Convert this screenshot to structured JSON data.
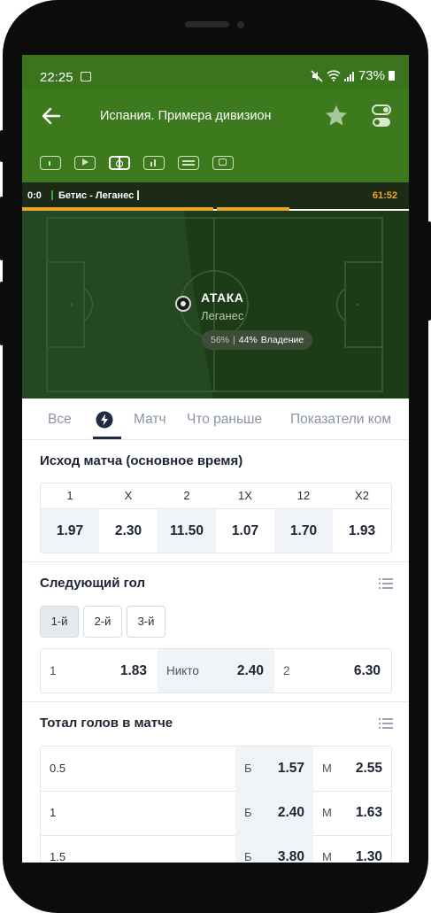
{
  "status": {
    "time": "22:25",
    "battery": "73%"
  },
  "header": {
    "title": "Испания. Примера дивизион"
  },
  "scoreboard": {
    "score": "0:0",
    "match": "Бетис - Леганес",
    "clock": "61:52"
  },
  "field": {
    "event": "АТАКА",
    "team": "Леганес",
    "possession_home": "56%",
    "possession_away": "44%",
    "possession_label": "Владение"
  },
  "tabs": [
    {
      "label": "Все"
    },
    {
      "label": "Матч"
    },
    {
      "label": "Что раньше"
    },
    {
      "label": "Показатели ком"
    }
  ],
  "match_result": {
    "title": "Исход матча (основное время)",
    "columns": [
      "1",
      "X",
      "2",
      "1X",
      "12",
      "X2"
    ],
    "odds": [
      "1.97",
      "2.30",
      "11.50",
      "1.07",
      "1.70",
      "1.93"
    ]
  },
  "next_goal": {
    "title": "Следующий гол",
    "chips": [
      "1-й",
      "2-й",
      "3-й"
    ],
    "options": [
      {
        "label": "1",
        "odds": "1.83"
      },
      {
        "label": "Никто",
        "odds": "2.40"
      },
      {
        "label": "2",
        "odds": "6.30"
      }
    ]
  },
  "total_goals": {
    "title": "Тотал голов в матче",
    "over_label": "Б",
    "under_label": "М",
    "rows": [
      {
        "line": "0.5",
        "over": "1.57",
        "under": "2.55"
      },
      {
        "line": "1",
        "over": "2.40",
        "under": "1.63"
      },
      {
        "line": "1.5",
        "over": "3.80",
        "under": "1.30"
      }
    ]
  },
  "colors": {
    "header_green": "#3d7a1e",
    "field_green": "#24481f",
    "accent_orange": "#e8a52d",
    "text_dark": "#1d2433"
  }
}
